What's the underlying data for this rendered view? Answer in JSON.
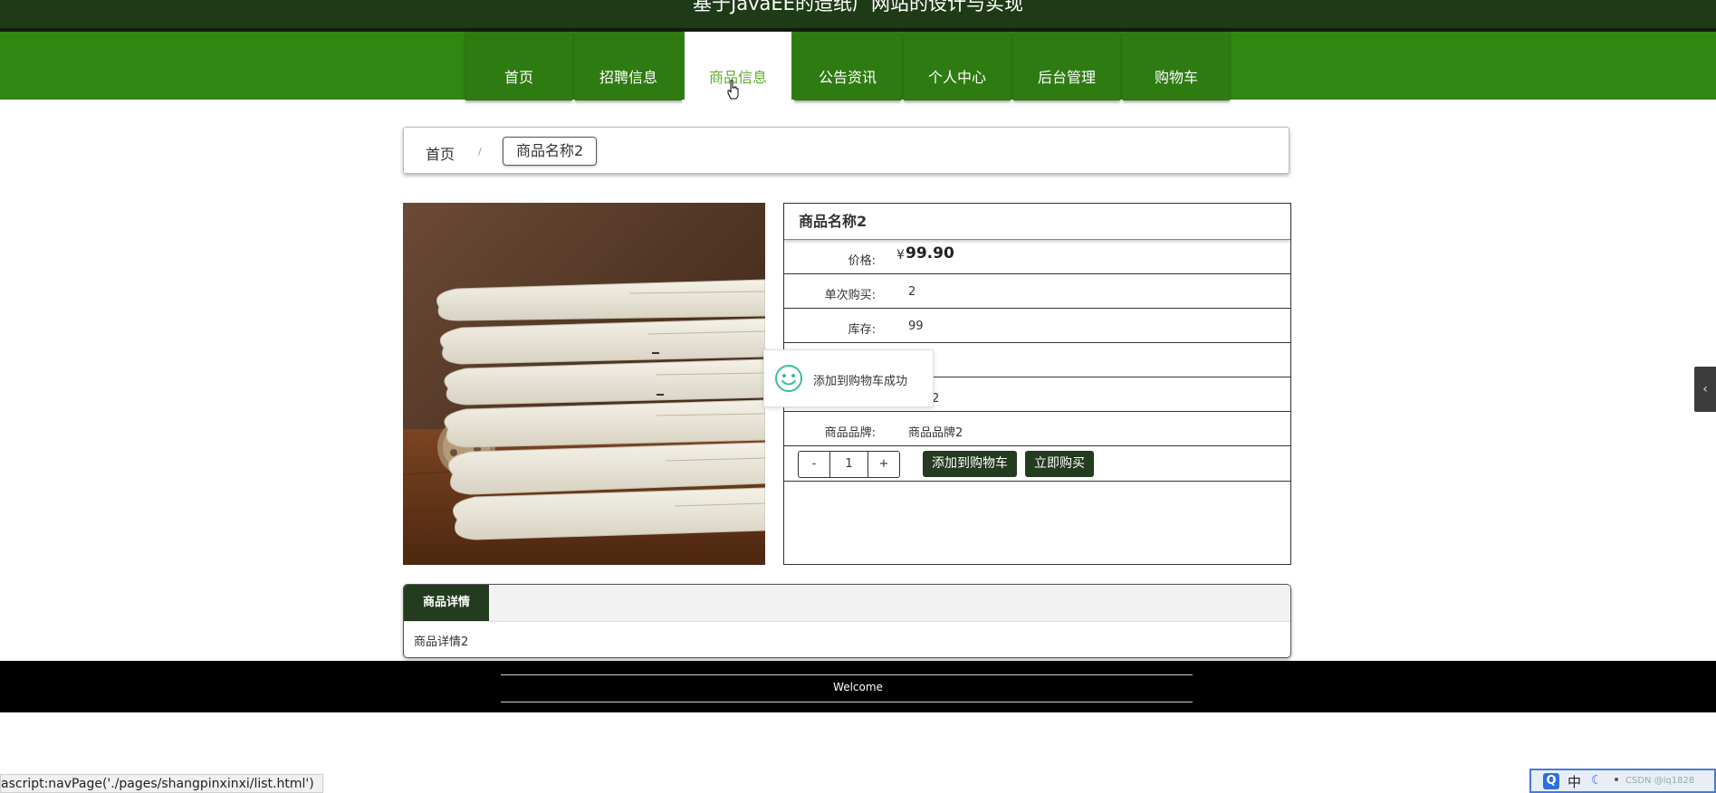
{
  "site_title": "基于JavaEE的造纸厂网站的设计与实现",
  "nav": {
    "items": [
      {
        "label": "首页"
      },
      {
        "label": "招聘信息"
      },
      {
        "label": "商品信息"
      },
      {
        "label": "公告资讯"
      },
      {
        "label": "个人中心"
      },
      {
        "label": "后台管理"
      },
      {
        "label": "购物车"
      }
    ],
    "active_index": 2
  },
  "breadcrumb": {
    "home": "首页",
    "separator": "/",
    "current": "商品名称2"
  },
  "product": {
    "name": "商品名称2",
    "price_label": "价格:",
    "price_currency": "¥",
    "price_value": "99.90",
    "rows": [
      {
        "label": "单次购买:",
        "value": "2"
      },
      {
        "label": "库存:",
        "value": "99"
      },
      {
        "label": "",
        "value": ""
      },
      {
        "label": "",
        "value": "规格2"
      },
      {
        "label": "商品品牌:",
        "value": "商品品牌2"
      }
    ],
    "quantity": "1",
    "qty_minus": "-",
    "qty_plus": "+",
    "add_to_cart": "添加到购物车",
    "buy_now": "立即购买"
  },
  "toast": {
    "message": "添加到购物车成功",
    "icon": "smile-icon"
  },
  "details": {
    "tab_label": "商品详情",
    "content": "商品详情2"
  },
  "footer": {
    "text": "Welcome"
  },
  "side_toggle": "‹",
  "statusbar": {
    "text": "ascript:navPage('./pages/shangpinxinxi/list.html')"
  },
  "ime": {
    "q": "Q",
    "lang": "中",
    "watermark": "CSDN @lq1828"
  },
  "colors": {
    "nav_bg": "#318712",
    "nav_item_bg": "#2e7b11",
    "active_text": "#5cae2a",
    "title_bar": "#1f3a16",
    "dark_button": "#233b1e"
  }
}
